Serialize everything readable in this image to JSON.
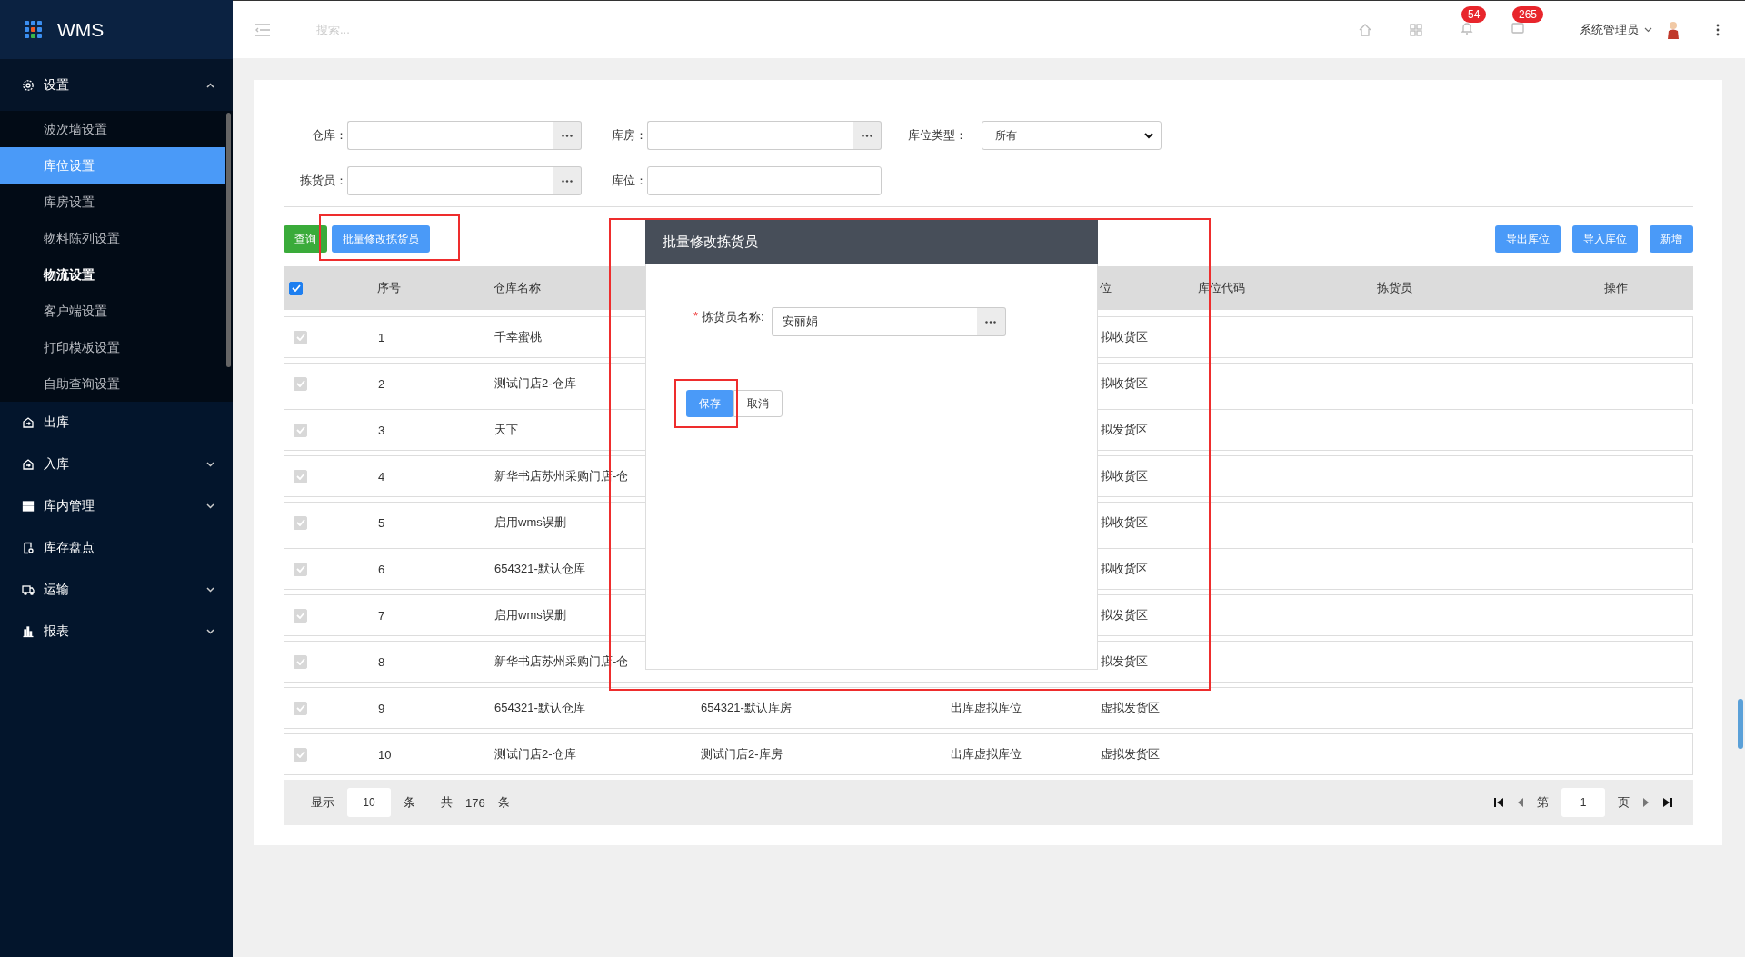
{
  "app": {
    "title": "WMS"
  },
  "sidebar": {
    "items": [
      {
        "label": "设置",
        "kind": "group",
        "expanded": true,
        "selected": false,
        "children": [
          {
            "label": "波次墙设置",
            "selected": false,
            "hovered": false
          },
          {
            "label": "库位设置",
            "selected": true,
            "hovered": false
          },
          {
            "label": "库房设置",
            "selected": false,
            "hovered": false
          },
          {
            "label": "物料陈列设置",
            "selected": false,
            "hovered": false
          },
          {
            "label": "物流设置",
            "selected": false,
            "hovered": true
          },
          {
            "label": "客户端设置",
            "selected": false,
            "hovered": false
          },
          {
            "label": "打印模板设置",
            "selected": false,
            "hovered": false
          },
          {
            "label": "自助查询设置",
            "selected": false,
            "hovered": false
          }
        ]
      },
      {
        "label": "出库",
        "kind": "link",
        "selected": false
      },
      {
        "label": "入库",
        "kind": "group",
        "expanded": false,
        "selected": false
      },
      {
        "label": "库内管理",
        "kind": "group",
        "expanded": false,
        "selected": false
      },
      {
        "label": "库存盘点",
        "kind": "link",
        "selected": false
      },
      {
        "label": "运输",
        "kind": "group",
        "expanded": false,
        "selected": false
      },
      {
        "label": "报表",
        "kind": "group",
        "expanded": false,
        "selected": false
      }
    ]
  },
  "topbar": {
    "search": {
      "placeholder": "搜索..."
    },
    "badges": [
      "54",
      "265"
    ],
    "user": "系统管理员"
  },
  "filters": [
    {
      "label": "仓库：",
      "kind": "lookup"
    },
    {
      "label": "库房：",
      "kind": "lookup"
    },
    {
      "label": "库位类型：",
      "kind": "select",
      "value": "所有"
    },
    {
      "label": "拣货员：",
      "kind": "lookup"
    },
    {
      "label": "库位：",
      "kind": "text"
    }
  ],
  "toolbar": {
    "left": [
      {
        "label": "查询",
        "kind": "success"
      },
      {
        "label": "批量修改拣货员",
        "kind": "primary"
      }
    ],
    "right": [
      {
        "label": "导出库位",
        "kind": "primary"
      },
      {
        "label": "导入库位",
        "kind": "primary"
      },
      {
        "label": "新增",
        "kind": "primary"
      }
    ]
  },
  "table": {
    "all_checked": true,
    "columns": {
      "no": "序号",
      "warehouse": "仓库名称",
      "area": "位",
      "code": "库位代码",
      "picker": "拣货员",
      "actions": "操作"
    },
    "rows": [
      {
        "checked": true,
        "disabled": true,
        "no": "1",
        "warehouse": "千幸蜜桃",
        "area": "拟收货区"
      },
      {
        "checked": true,
        "disabled": true,
        "no": "2",
        "warehouse": "测试门店2-仓库",
        "area": "拟收货区"
      },
      {
        "checked": true,
        "disabled": true,
        "no": "3",
        "warehouse": "天下",
        "area": "拟发货区"
      },
      {
        "checked": true,
        "disabled": true,
        "no": "4",
        "warehouse": "新华书店苏州采购门店-仓",
        "area": "拟收货区"
      },
      {
        "checked": true,
        "disabled": true,
        "no": "5",
        "warehouse": "启用wms误删",
        "area": "拟收货区"
      },
      {
        "checked": true,
        "disabled": true,
        "no": "6",
        "warehouse": "654321-默认仓库",
        "area": "拟收货区"
      },
      {
        "checked": true,
        "disabled": true,
        "no": "7",
        "warehouse": "启用wms误删",
        "area": "拟发货区"
      },
      {
        "checked": true,
        "disabled": true,
        "no": "8",
        "warehouse": "新华书店苏州采购门店-仓",
        "area": "拟发货区"
      },
      {
        "checked": true,
        "disabled": true,
        "no": "9",
        "warehouse": "654321-默认仓库",
        "room": "654321-默认库房",
        "location": "出库虚拟库位",
        "area": "虚拟发货区"
      },
      {
        "checked": true,
        "disabled": true,
        "no": "10",
        "warehouse": "测试门店2-仓库",
        "room": "测试门店2-库房",
        "location": "出库虚拟库位",
        "area": "虚拟发货区"
      }
    ]
  },
  "pagination": {
    "show_label": "显示",
    "page_size": "10",
    "unit": "条",
    "total_label": "共",
    "total": "176",
    "total_unit": "条",
    "page_label": "第",
    "page": "1",
    "page_unit": "页"
  },
  "dialog": {
    "title": "批量修改拣货员",
    "field": {
      "required_mark": "*",
      "label": "拣货员名称:",
      "value": "安丽娟"
    },
    "buttons": [
      {
        "label": "保存",
        "kind": "primary"
      },
      {
        "label": "取消",
        "kind": "default"
      }
    ]
  }
}
